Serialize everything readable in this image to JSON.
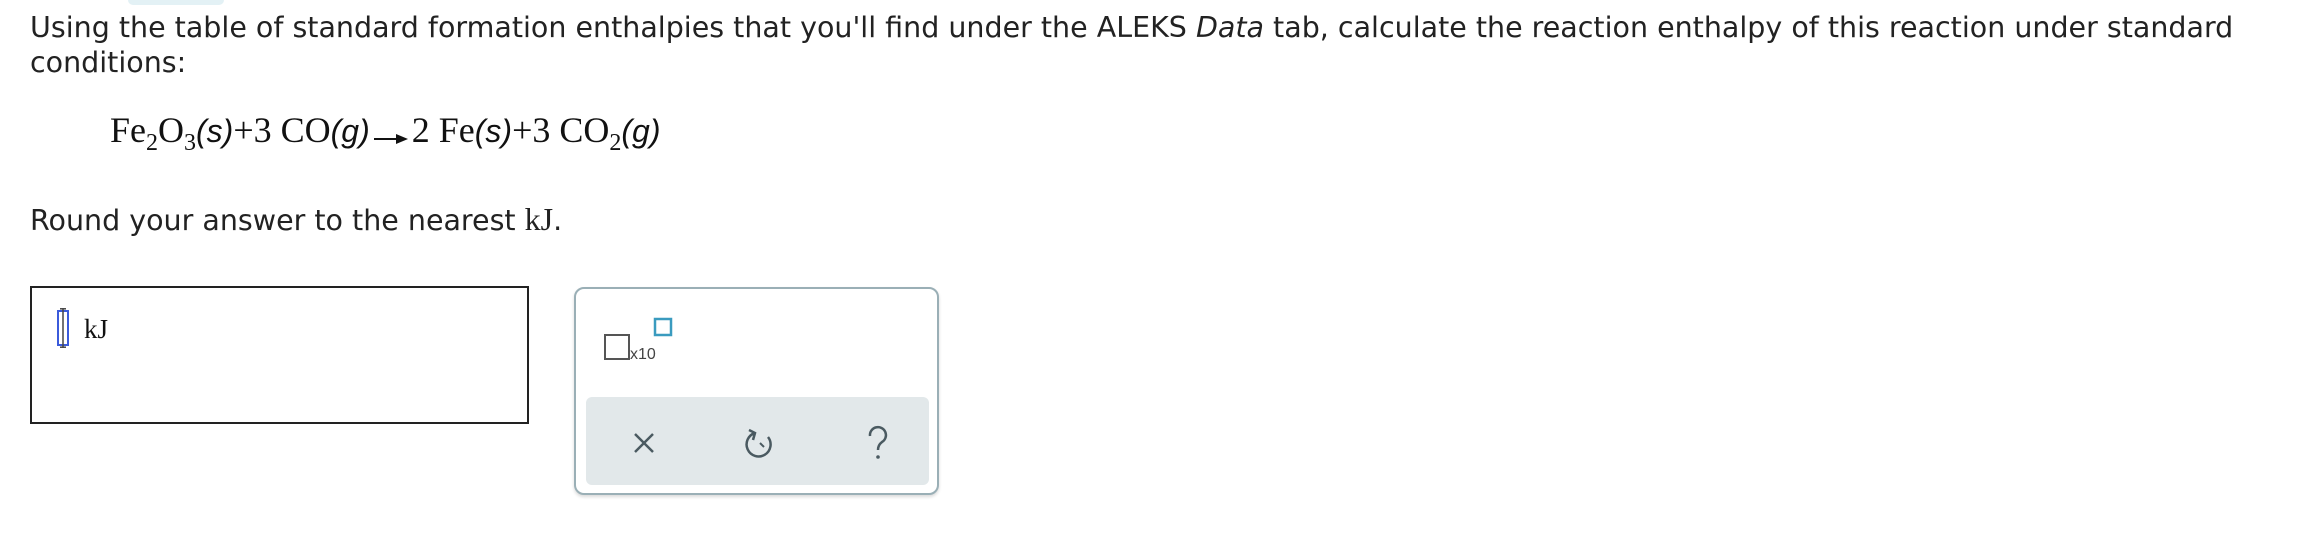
{
  "prompt": {
    "text_before_data": "Using the table of standard formation enthalpies that you'll find under the ALEKS ",
    "data_word": "Data",
    "text_after_data": " tab, calculate the reaction enthalpy of this reaction under standard conditions:"
  },
  "equation": {
    "reactant1_formula": "Fe",
    "reactant1_sub1": "2",
    "reactant1_mid": "O",
    "reactant1_sub2": "3",
    "reactant1_state": "(s)",
    "plus1": "+",
    "reactant2_coef": "3",
    "reactant2_formula": "CO",
    "reactant2_state": "(g)",
    "product1_coef": "2",
    "product1_formula": "Fe",
    "product1_state": "(s)",
    "plus2": "+",
    "product2_coef": "3",
    "product2_formula": "CO",
    "product2_sub": "2",
    "product2_state": "(g)"
  },
  "instruction": {
    "text": "Round your answer to the nearest ",
    "unit": "kJ",
    "end": "."
  },
  "answer": {
    "value": "",
    "unit": "kJ"
  },
  "tools": {
    "sci_notation_label": "x10",
    "sci_icon": "scientific-notation-icon",
    "clear_icon": "close-icon",
    "undo_icon": "undo-icon",
    "help_icon": "help-icon"
  },
  "colors": {
    "accent_teal": "#3a9bbf",
    "cursor_blue": "#3b5bdb",
    "panel_border": "#9aafb6",
    "action_bar_bg": "#e2e8ea",
    "icon_gray": "#4a5a61"
  }
}
